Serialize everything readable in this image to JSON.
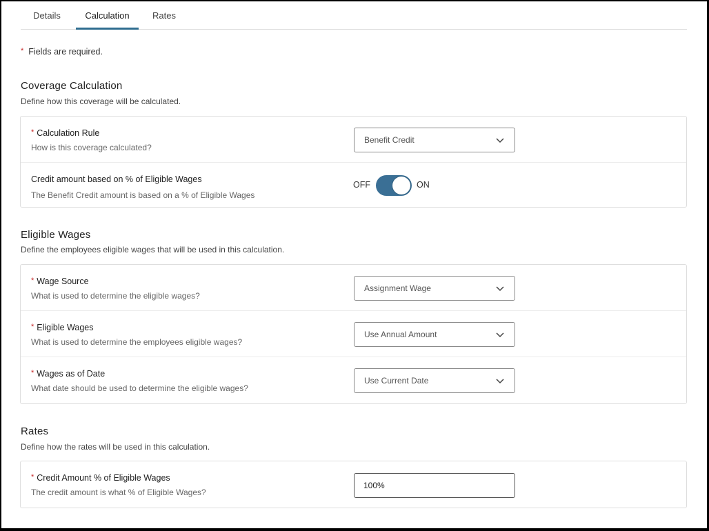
{
  "tabs": [
    {
      "label": "Details",
      "active": false
    },
    {
      "label": "Calculation",
      "active": true
    },
    {
      "label": "Rates",
      "active": false
    }
  ],
  "required_note": {
    "marker": "*",
    "text": "Fields are required."
  },
  "coverage": {
    "title": "Coverage Calculation",
    "description": "Define how this coverage will be calculated.",
    "calculation_rule": {
      "required": "*",
      "label": "Calculation Rule",
      "help": "How is this coverage calculated?",
      "value": "Benefit Credit"
    },
    "credit_toggle": {
      "label": "Credit amount based on % of Eligible Wages",
      "help": "The Benefit Credit amount is based on a % of Eligible Wages",
      "off_label": "OFF",
      "on_label": "ON",
      "state": "on"
    }
  },
  "eligible_wages": {
    "title": "Eligible Wages",
    "description": "Define the employees eligible wages that will be used in this calculation.",
    "wage_source": {
      "required": "*",
      "label": "Wage Source",
      "help": "What is used to determine the eligible wages?",
      "value": "Assignment Wage"
    },
    "eligible_wages_field": {
      "required": "*",
      "label": "Eligible Wages",
      "help": "What is used to determine the employees eligible wages?",
      "value": "Use Annual Amount"
    },
    "wages_as_of_date": {
      "required": "*",
      "label": "Wages as of Date",
      "help": "What date should be used to determine the eligible wages?",
      "value": "Use Current Date"
    }
  },
  "rates": {
    "title": "Rates",
    "description": "Define how the rates will be used in this calculation.",
    "credit_amount_pct": {
      "required": "*",
      "label": "Credit Amount % of Eligible Wages",
      "help": "The credit amount is what % of Eligible Wages?",
      "value": "100%"
    }
  },
  "colors": {
    "accent": "#2f6d8f",
    "toggle_on": "#3a6f95",
    "required": "#c62828"
  },
  "icons": {
    "dropdown": "chevron-down-icon"
  }
}
